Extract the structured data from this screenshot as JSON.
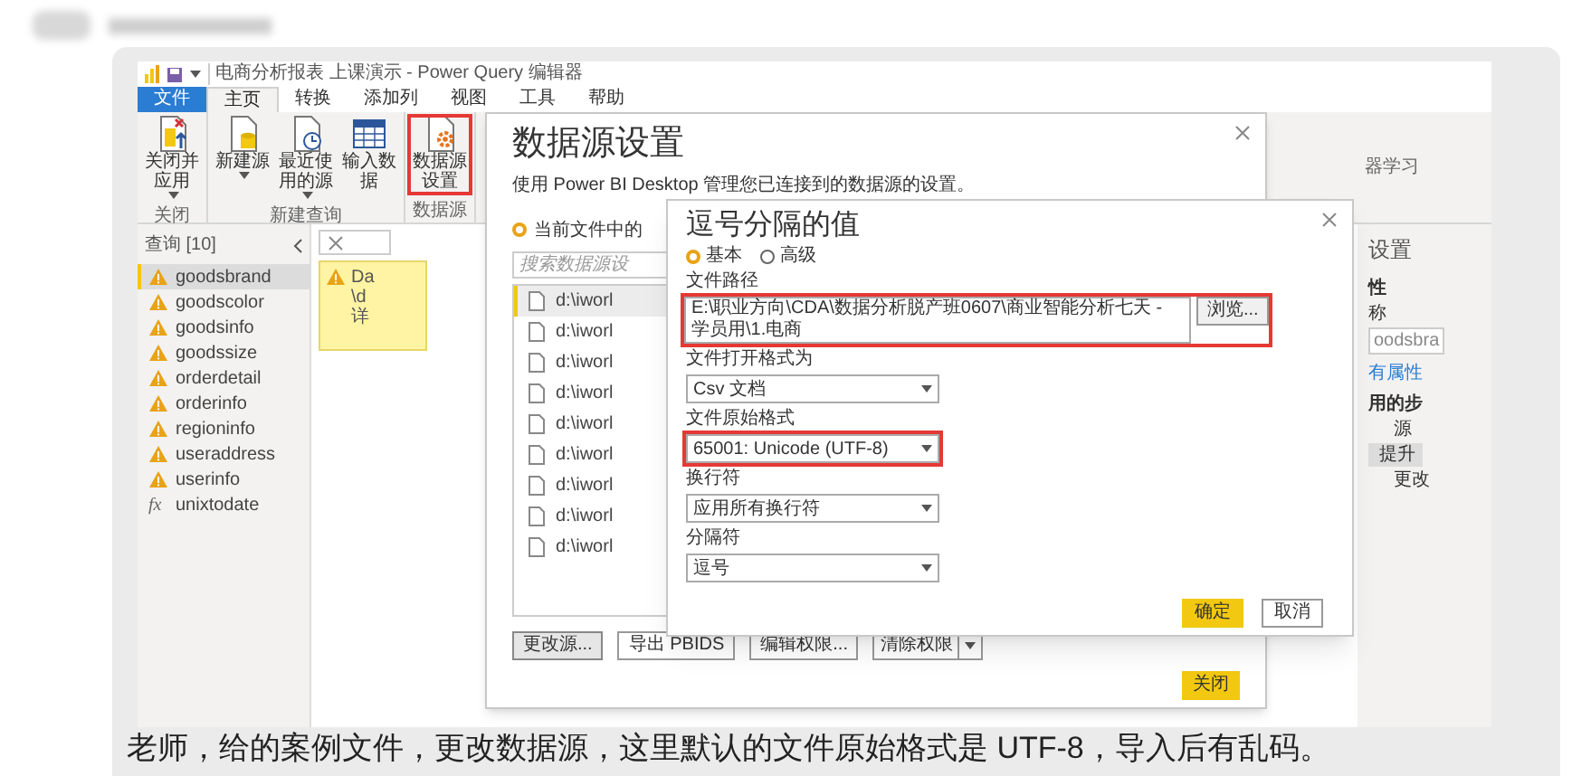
{
  "window": {
    "title": "电商分析报表 上课演示 - Power Query 编辑器"
  },
  "ribbon_tabs": [
    {
      "label": "文件",
      "kind": "file",
      "selected": false
    },
    {
      "label": "主页",
      "kind": "tab",
      "selected": true
    },
    {
      "label": "转换",
      "kind": "tab",
      "selected": false
    },
    {
      "label": "添加列",
      "kind": "tab",
      "selected": false
    },
    {
      "label": "视图",
      "kind": "tab",
      "selected": false
    },
    {
      "label": "工具",
      "kind": "tab",
      "selected": false
    },
    {
      "label": "帮助",
      "kind": "tab",
      "selected": false
    }
  ],
  "ribbon_groups": [
    {
      "label": "关闭",
      "buttons": [
        {
          "label": "关闭并应用",
          "dropdown": true,
          "highlighted": false
        }
      ]
    },
    {
      "label": "新建查询",
      "buttons": [
        {
          "label": "新建源",
          "dropdown": true,
          "highlighted": false
        },
        {
          "label": "最近使用的源",
          "dropdown": true,
          "highlighted": false
        },
        {
          "label": "输入数据",
          "dropdown": false,
          "highlighted": false
        }
      ]
    },
    {
      "label": "数据源",
      "buttons": [
        {
          "label": "数据源设置",
          "dropdown": false,
          "highlighted": true
        }
      ]
    }
  ],
  "ribbon_partial": "器学习",
  "queries": {
    "title": "查询 [10]",
    "items": [
      {
        "name": "goodsbrand",
        "kind": "warning",
        "selected": true
      },
      {
        "name": "goodscolor",
        "kind": "warning",
        "selected": false
      },
      {
        "name": "goodsinfo",
        "kind": "warning",
        "selected": false
      },
      {
        "name": "goodssize",
        "kind": "warning",
        "selected": false
      },
      {
        "name": "orderdetail",
        "kind": "warning",
        "selected": false
      },
      {
        "name": "orderinfo",
        "kind": "warning",
        "selected": false
      },
      {
        "name": "regioninfo",
        "kind": "warning",
        "selected": false
      },
      {
        "name": "useraddress",
        "kind": "warning",
        "selected": false
      },
      {
        "name": "userinfo",
        "kind": "warning",
        "selected": false
      },
      {
        "name": "unixtodate",
        "kind": "function",
        "symbol": "fx",
        "selected": false
      }
    ]
  },
  "preview": {
    "warning_lines": [
      "Da",
      "\\d",
      "详"
    ]
  },
  "side_panel": [
    {
      "text": "设置",
      "kind": "heading"
    },
    {
      "text": "性",
      "kind": "bold"
    },
    {
      "text": "称",
      "kind": "text"
    },
    {
      "text": "oodsbra",
      "kind": "field"
    },
    {
      "text": "有属性",
      "kind": "link"
    },
    {
      "text": "用的步",
      "kind": "bold"
    },
    {
      "text": "源",
      "kind": "step",
      "selected": false
    },
    {
      "text": "提升",
      "kind": "step",
      "selected": true
    },
    {
      "text": "更改",
      "kind": "step",
      "selected": false
    }
  ],
  "data_source_dialog": {
    "title": "数据源设置",
    "description": "使用 Power BI Desktop 管理您已连接到的数据源的设置。",
    "scope_option": {
      "label": "当前文件中的",
      "selected": true
    },
    "search": {
      "placeholder": "搜索数据源设"
    },
    "sources": [
      {
        "path": "d:\\iworl",
        "selected": true
      },
      {
        "path": "d:\\iworl",
        "selected": false
      },
      {
        "path": "d:\\iworl",
        "selected": false
      },
      {
        "path": "d:\\iworl",
        "selected": false
      },
      {
        "path": "d:\\iworl",
        "selected": false
      },
      {
        "path": "d:\\iworl",
        "selected": false
      },
      {
        "path": "d:\\iworl",
        "selected": false
      },
      {
        "path": "d:\\iworl",
        "selected": false
      },
      {
        "path": "d:\\iworl",
        "selected": false
      }
    ],
    "buttons": [
      {
        "label": "更改源...",
        "kind": "default"
      },
      {
        "label": "导出 PBIDS",
        "kind": "button"
      },
      {
        "label": "编辑权限...",
        "kind": "button"
      },
      {
        "label": "清除权限",
        "kind": "split"
      }
    ],
    "close_button": "关闭"
  },
  "csv_dialog": {
    "title": "逗号分隔的值",
    "modes": [
      {
        "label": "基本",
        "selected": true
      },
      {
        "label": "高级",
        "selected": false
      }
    ],
    "fields": [
      {
        "label": "文件路径",
        "kind": "file",
        "value": "E:\\职业方向\\CDA\\数据分析脱产班0607\\商业智能分析七天 - 学员用\\1.电商",
        "browse": "浏览...",
        "highlighted": true
      },
      {
        "label": "文件打开格式为",
        "kind": "select",
        "value": "Csv 文档",
        "highlighted": false
      },
      {
        "label": "文件原始格式",
        "kind": "select",
        "value": "65001: Unicode (UTF-8)",
        "highlighted": true
      },
      {
        "label": "换行符",
        "kind": "select",
        "value": "应用所有换行符",
        "highlighted": false
      },
      {
        "label": "分隔符",
        "kind": "select",
        "value": "逗号",
        "highlighted": false
      }
    ],
    "ok": "确定",
    "cancel": "取消"
  },
  "comment": "老师，给的案例文件，更改数据源，这里默认的文件原始格式是 UTF-8，导入后有乱码。"
}
